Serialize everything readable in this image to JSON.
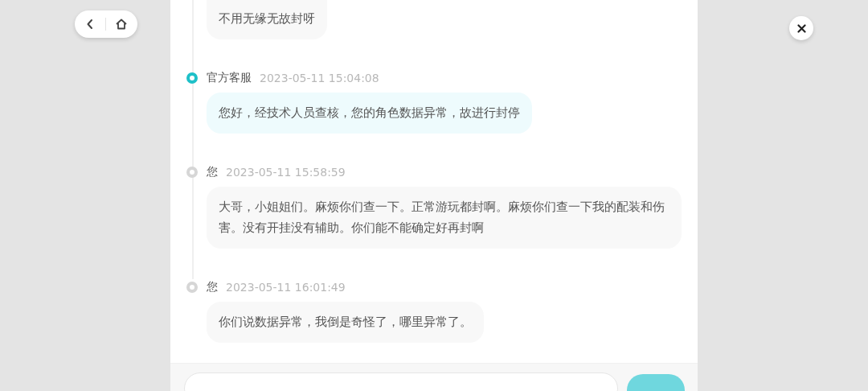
{
  "messages": [
    {
      "kind": "user",
      "text": "不用无缘无故封呀"
    },
    {
      "kind": "staff",
      "sender": "官方客服",
      "time": "2023-05-11 15:04:08",
      "text": "您好，经技术人员查核，您的角色数据异常，故进行封停"
    },
    {
      "kind": "user",
      "sender": "您",
      "time": "2023-05-11 15:58:59",
      "text": "大哥，小姐姐们。麻烦你们查一下。正常游玩都封啊。麻烦你们查一下我的配装和伤害。没有开挂没有辅助。你们能不能确定好再封啊"
    },
    {
      "kind": "user",
      "sender": "您",
      "time": "2023-05-11 16:01:49",
      "text": "你们说数据异常，我倒是奇怪了，哪里异常了。"
    }
  ]
}
